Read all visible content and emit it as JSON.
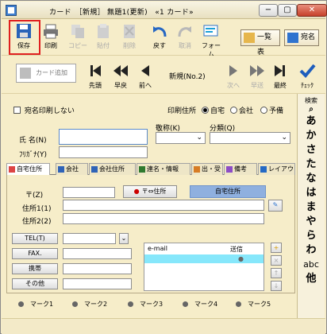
{
  "title": {
    "text": "カード　［新規］ 無題1(更新)　«1 カード»"
  },
  "window": {
    "minimize": "−",
    "maximize": "▢",
    "close": "✕"
  },
  "toolbar": {
    "save": "保存",
    "print": "印刷",
    "copy": "コピー",
    "paste": "貼付",
    "delete": "削除",
    "undo": "戻す",
    "cancel": "取消",
    "form": "フォーム",
    "list": "一覧表",
    "address": "宛名"
  },
  "nav": {
    "add_card": "カード追加",
    "first": "先頭",
    "fast_prev": "早戻",
    "prev": "前へ",
    "status": "新規(No.2)",
    "next": "次へ",
    "fast_next": "早送",
    "last": "最終",
    "check": "ﾁｪｯｸ"
  },
  "form": {
    "no_address_print": "宛名印刷しない",
    "print_address": "印刷住所",
    "home": "自宅",
    "company": "会社",
    "reserve": "予備",
    "title_label": "敬称(K)",
    "category_label": "分類(Q)",
    "name_label": "氏 名(N)",
    "furigana_label": "ﾌﾘｶﾞﾅ(Y)",
    "name_value": "",
    "furigana_value": ""
  },
  "tabs": [
    {
      "label": "自宅住所"
    },
    {
      "label": "会社"
    },
    {
      "label": "会社住所"
    },
    {
      "label": "連名・情報"
    },
    {
      "label": "出・受"
    },
    {
      "label": "備考"
    },
    {
      "label": "レイアウト"
    }
  ],
  "panel": {
    "postal_label": "〒(Z)",
    "postal_btn": "〒⇔住所",
    "address_type": "自宅住所",
    "address1_label": "住所1(1)",
    "address2_label": "住所2(2)",
    "tel": "TEL(T)",
    "fax": "FAX.",
    "mobile": "携帯",
    "other": "その他",
    "email_header": "e-mail",
    "send_header": "送信"
  },
  "marks": [
    "マーク1",
    "マーク2",
    "マーク3",
    "マーク4",
    "マーク5"
  ],
  "index": {
    "search": "検索",
    "chars": [
      "あ",
      "か",
      "さ",
      "た",
      "な",
      "は",
      "ま",
      "や",
      "ら",
      "わ"
    ],
    "abc": "abc",
    "other": "他"
  }
}
